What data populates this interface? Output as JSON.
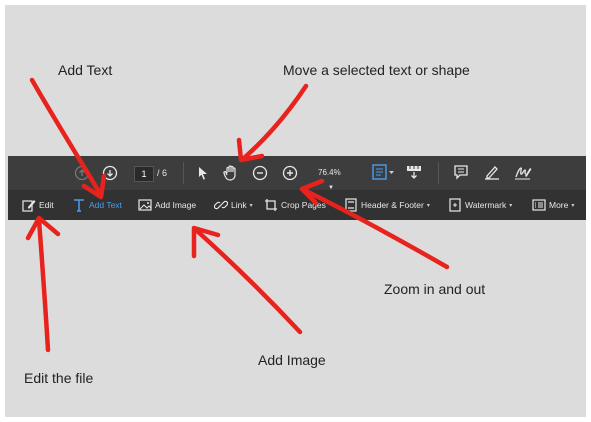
{
  "toolbar": {
    "page_current": "1",
    "page_total": "/ 6",
    "zoom_value": "76.4%",
    "zoom_caret": "▼",
    "buttons": {
      "edit": "Edit",
      "add_text": "Add Text",
      "add_image": "Add Image",
      "link": "Link",
      "crop_pages": "Crop Pages",
      "header_footer": "Header & Footer",
      "watermark": "Watermark",
      "more": "More"
    },
    "caret": "▾"
  },
  "annotations": {
    "add_text": "Add Text",
    "move_selected": "Move a selected text or shape",
    "zoom": "Zoom in  and out",
    "add_image": "Add Image",
    "edit_file": "Edit the file"
  },
  "colors": {
    "arrow": "#e8221c",
    "active_blue": "#4a9df0",
    "toolbar_dark": "#3d3d3d",
    "background": "#dcdcdc"
  },
  "icons": [
    "arrow-up-circle-icon",
    "arrow-down-circle-icon",
    "select-cursor-icon",
    "hand-icon",
    "zoom-out-icon",
    "zoom-in-icon",
    "page-fit-icon",
    "scroll-mode-icon",
    "comment-icon",
    "highlight-pen-icon",
    "sign-icon",
    "edit-icon",
    "add-text-icon",
    "add-image-icon",
    "link-icon",
    "crop-icon",
    "header-footer-icon",
    "watermark-icon",
    "more-icon"
  ]
}
